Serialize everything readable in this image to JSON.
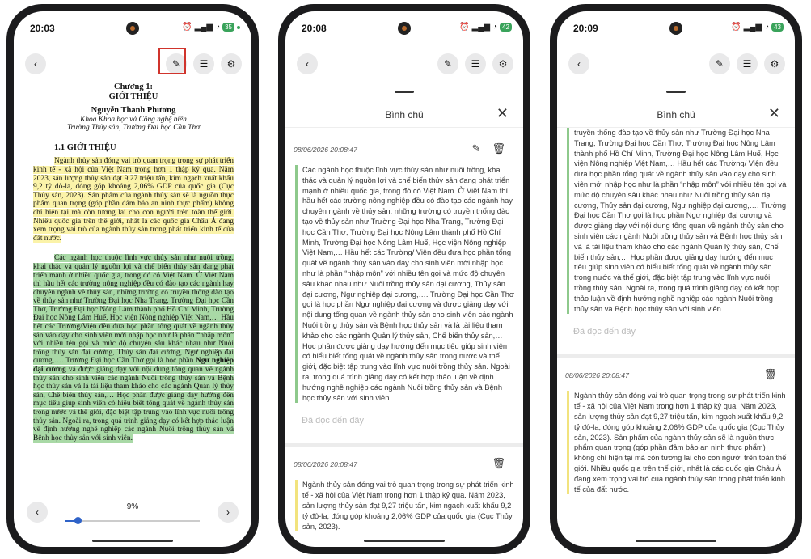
{
  "screen1": {
    "time": "20:03",
    "battery": "35",
    "chapter": "Chương 1:",
    "chapter_title": "GIỚI THIỆU",
    "author": "Nguyễn Thanh Phương",
    "faculty": "Khoa Khoa học và Công nghệ biển",
    "university": "Trường Thủy sản, Trường Đại học Cần Thơ",
    "section": "1.1 GIỚI THIỆU",
    "para1": "Ngành thủy sản đóng vai trò quan trọng trong sự phát triển kinh tế - xã hội của Việt Nam trong hơn 1 thập kỷ qua. Năm 2023, sản lượng thủy sản đạt 9,27 triệu tấn, kim ngạch xuất khẩu 9,2 tỷ đô-la, đóng góp khoảng 2,06% GDP của quốc gia (Cục Thủy sản, 2023). Sản phẩm của ngành thủy sản sẽ là nguồn thực phẩm quan trọng (góp phần đảm bảo an ninh thực phẩm) không chỉ hiện tại mà còn tương lai cho con người trên toàn thế giới. Nhiều quốc gia trên thế giới, nhất là các quốc gia Châu Á đang xem trọng vai trò của ngành thủy sản trong phát triển kinh tế của đất nước.",
    "para2_a": "Các ngành học thuộc lĩnh vực thủy sản như nuôi trồng, khai thác và quản lý nguồn lợi và chế biến thủy sản đang phát triển mạnh ở nhiều quốc gia, trong đó có Việt Nam. Ở Việt Nam thì hầu hết các trường nông nghiệp đều có đào tạo các ngành hay chuyên ngành về thủy sản, những trường có truyền thống đào tạo về thủy sản như Trường Đại học Nha Trang, Trường Đại học Cần Thơ, Trường Đại học Nông Lâm thành phố Hồ Chí Minh, Trường Đại học Nông Lâm Huế, Học viện Nông nghiệp Việt Nam,…  Hầu hết các Trường/Viện đều đưa học phần tổng quát về ngành thủy sản vào dạy cho sinh viên mới nhập học như là phần “nhập môn” với nhiều tên gọi và mức độ chuyên sâu khác nhau như Nuôi trồng thủy sản đại cương, Thủy sản đại cương, Ngư nghiệp đại cương,…. Trường Đại học Cần Thơ gọi là học phần ",
    "para2_bold": "Ngư nghiệp đại cương",
    "para2_b": " và được giảng dạy với nội dung tổng quan về ngành thủy sản cho sinh viên các ngành Nuôi trồng thủy sản và Bệnh học thủy sản và là tài liệu tham khảo cho các ngành Quản lý thủy sản, Chế biến thủy sản,… Học phần được giảng dạy hướng đến mục tiêu giúp sinh viên có hiểu biết tổng quát về ngành thủy sản trong nước và thế giới, đặc biệt tập trung vào lĩnh vực nuôi trồng thủy sản. Ngoài ra, trong quá trình giảng dạy có kết hợp thảo luận về định hướng nghề nghiệp các ngành Nuôi trồng thủy sản và Bệnh học thủy sản với sinh viên.",
    "progress_label": "9%",
    "progress": 0.09
  },
  "screen2": {
    "time": "20:08",
    "battery": "42",
    "panel_title": "Bình chú",
    "notes": [
      {
        "date": "08/06/2026 20:08:47",
        "text": "Các ngành học thuộc lĩnh vực thủy sản như nuôi trồng, khai thác và quản lý nguồn lợi và chế biến thủy sản đang phát triển mạnh ở nhiều quốc gia, trong đó có Việt Nam. Ở Việt Nam thì hầu hết các trường nông nghiệp đều có đào tạo các ngành hay chuyên ngành về thủy sản, những trường có truyền thống đào tạo về thủy sản như Trường Đại học Nha Trang, Trường Đại học Cần Thơ, Trường Đại học Nông Lâm thành phố Hồ Chí Minh, Trường Đại học Nông Lâm Huế, Học viện Nông nghiệp Việt Nam,…  Hầu hết các Trường/ Viện đều đưa học phần tổng quát về ngành thủy sản vào dạy cho sinh viên mới nhập học như là phần “nhập môn” với nhiều tên gọi và mức độ chuyên sâu khác nhau như Nuôi trồng thủy sản đại cương, Thủy sản đại cương, Ngư nghiệp đại cương,…. Trường Đại học Cần Thơ gọi là học phần Ngư nghiệp đại cương và được giảng dạy với nội dung tổng quan về ngành thủy sản cho sinh viên các ngành Nuôi trồng thủy sản và Bệnh học thủy sản và là tài liệu tham khảo cho các ngành Quản lý thủy sản, Chế biến thủy sản,… Học phần được giảng dạy hướng đến mục tiêu giúp sinh viên có hiểu biết tổng quát về ngành thủy sản trong nước và thế giới, đặc biệt tập trung vào lĩnh vực nuôi trồng thủy sản. Ngoài ra, trong quá trình giảng dạy có kết hợp thảo luận về định hướng nghề nghiệp các ngành Nuôi trồng thủy sản và Bệnh học thủy sản với sinh viên.",
        "placeholder": "Đã đọc đến đây"
      },
      {
        "date": "08/06/2026 20:08:47",
        "text": "Ngành thủy sản đóng vai trò quan trọng trong sự phát triển kinh tế - xã hội của Việt Nam trong hơn 1 thập kỷ qua. Năm 2023, sản lượng thủy sản đạt 9,27 triệu tấn, kim ngạch xuất khẩu 9,2 tỷ đô-la, đóng góp khoảng 2,06% GDP của quốc gia (Cục Thủy sản, 2023)."
      }
    ]
  },
  "screen3": {
    "time": "20:09",
    "battery": "43",
    "panel_title": "Bình chú",
    "note1_tail": "truyền thống đào tạo về thủy sản như Trường Đại học Nha Trang, Trường Đại học Cần Thơ, Trường Đại học Nông Lâm thành phố Hồ Chí Minh, Trường Đại học Nông Lâm Huế, Học viện Nông nghiệp Việt Nam,…  Hầu hết các Trường/ Viện đều đưa học phần tổng quát về ngành thủy sản vào dạy cho sinh viên mới nhập học như là phần “nhập môn” với nhiều tên gọi và mức độ chuyên sâu khác nhau như Nuôi trồng thủy sản đại cương, Thủy sản đại cương, Ngư nghiệp đại cương,…. Trường Đại học Cần Thơ gọi là học phần Ngư nghiệp đại cương và được giảng dạy với nội dung tổng quan về ngành thủy sản cho sinh viên các ngành Nuôi trồng thủy sản và Bệnh học thủy sản và là tài liệu tham khảo cho các ngành Quản lý thủy sản, Chế biến thủy sản,… Học phần được giảng dạy hướng đến mục tiêu giúp sinh viên có hiểu biết tổng quát về ngành thủy sản trong nước và thế giới, đặc biệt tập trung vào lĩnh vực nuôi trồng thủy sản. Ngoài ra, trong quá trình giảng dạy có kết hợp thảo luận về định hướng nghề nghiệp các ngành Nuôi trồng thủy sản và Bệnh học thủy sản với sinh viên.",
    "note1_placeholder": "Đã đọc đến đây",
    "note2_date": "08/06/2026 20:08:47",
    "note2_text": "Ngành thủy sản đóng vai trò quan trọng trong sự phát triển kinh tế - xã hội của Việt Nam trong hơn 1 thập kỷ qua. Năm 2023, sản lượng thủy sản đạt 9,27 triệu tấn, kim ngạch xuất khẩu 9,2 tỷ đô-la, đóng góp khoảng 2,06% GDP của quốc gia (Cục Thủy sản, 2023). Sản phẩm của ngành thủy sản sẽ là nguồn thực phẩm quan trọng (góp phần đảm bảo an ninh thực phẩm) không chỉ hiện tại mà còn tương lai cho con người trên toàn thế giới. Nhiều quốc gia trên thế giới, nhất là các quốc gia Châu Á đang xem trọng vai trò của ngành thủy sản trong phát triển kinh tế của đất nước."
  },
  "icons": {
    "back": "chevron-left-icon",
    "edit": "pencil-icon",
    "list": "list-icon",
    "settings": "gear-icon",
    "close": "close-icon",
    "delete": "trash-icon",
    "next": "chevron-right-icon"
  },
  "colors": {
    "highlight_yellow": "#fbf3a9",
    "highlight_green": "#a9d9a6",
    "accent_blue": "#2f63c8",
    "red_box": "#d0342c"
  }
}
